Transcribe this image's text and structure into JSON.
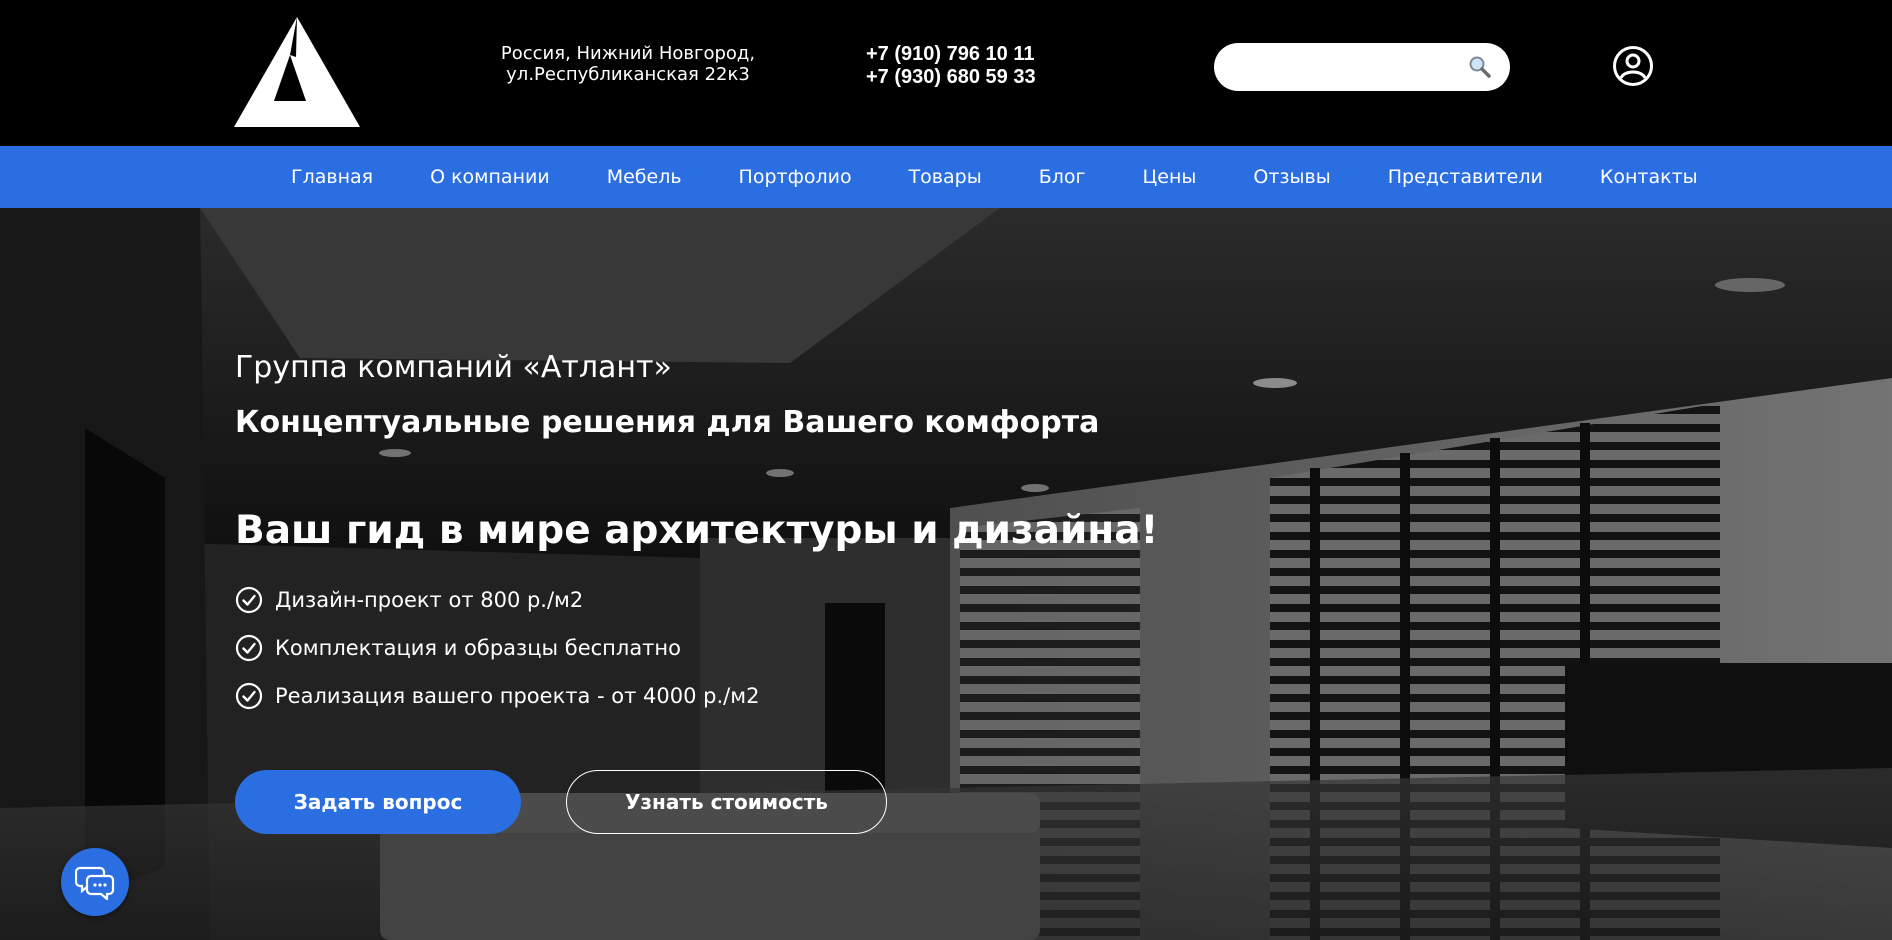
{
  "header": {
    "logo_icon": "atlant-triangle-logo",
    "address_line1": "Россия, Нижний Новгород,",
    "address_line2": "ул.Республиканская 22к3",
    "phone1": "+7 (910) 796 10 11",
    "phone2": "+7 (930) 680 59 33",
    "search": {
      "placeholder": "",
      "value": "",
      "icon": "magnifier-icon"
    },
    "account_icon": "user-circle-icon"
  },
  "nav": {
    "items": [
      {
        "label": "Главная"
      },
      {
        "label": "О компании"
      },
      {
        "label": "Мебель"
      },
      {
        "label": "Портфолио"
      },
      {
        "label": "Товары"
      },
      {
        "label": "Блог"
      },
      {
        "label": "Цены"
      },
      {
        "label": "Отзывы"
      },
      {
        "label": "Представители"
      },
      {
        "label": "Контакты"
      }
    ],
    "color": "#2a6ee1"
  },
  "hero": {
    "subtitle": "Группа компаний «Атлант»",
    "tagline": "Концептуальные решения для Вашего комфорта",
    "headline": "Ваш гид в мире архитектуры и дизайна!",
    "features": [
      {
        "text": "Дизайн-проект от 800 р./м2",
        "icon": "check-circle-icon"
      },
      {
        "text": "Комплектация и образцы бесплатно",
        "icon": "check-circle-icon"
      },
      {
        "text": "Реализация вашего проекта - от 4000 р./м2",
        "icon": "check-circle-icon"
      }
    ],
    "primary_button": "Задать вопрос",
    "secondary_button": "Узнать стоимость"
  },
  "chat_widget": {
    "icon": "chat-bubbles-icon"
  },
  "colors": {
    "accent": "#2a6ee1",
    "header_bg": "#000000",
    "text": "#ffffff"
  }
}
